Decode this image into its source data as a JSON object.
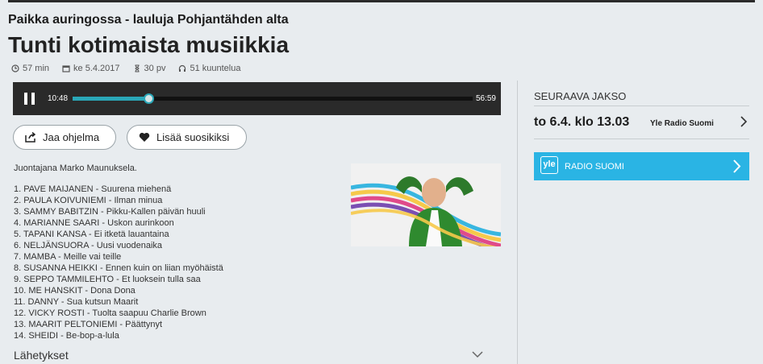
{
  "header": {
    "series": "Paikka auringossa - lauluja Pohjantähden alta",
    "title": "Tunti kotimaista musiikkia"
  },
  "meta": {
    "duration": "57 min",
    "date": "ke 5.4.2017",
    "availability": "30 pv",
    "listens": "51 kuuntelua"
  },
  "player": {
    "current_time": "10:48",
    "total_time": "56:59",
    "progress": 0.19
  },
  "actions": {
    "share_label": "Jaa ohjelma",
    "favorite_label": "Lisää suosikiksi"
  },
  "description": {
    "host": "Juontajana Marko Maunuksela."
  },
  "tracks": [
    "1. PAVE MAIJANEN - Suurena miehenä",
    "2. PAULA KOIVUNIEMI - Ilman minua",
    "3. SAMMY BABITZIN - Pikku-Kallen päivän huuli",
    "4. MARIANNE SAARI - Uskon aurinkoon",
    "5. TAPANI KANSA - Ei itketä lauantaina",
    "6. NELJÄNSUORA - Uusi vuodenaika",
    "7. MAMBA - Meille vai teille",
    "8. SUSANNA HEIKKI - Ennen kuin on liian myöhäistä",
    "9. SEPPO TAMMILEHTO - Et luoksein tulla saa",
    "10. ME HANSKIT - Dona Dona",
    "11. DANNY - Sua kutsun Maarit",
    "12. VICKY ROSTI - Tuolta saapuu Charlie Brown",
    "13. MAARIT PELTONIEMI - Päättynyt",
    "14. SHEIDI - Be-bop-a-lula"
  ],
  "broadcasts": {
    "label": "Lähetykset"
  },
  "next_episode": {
    "heading": "SEURAAVA JAKSO",
    "time": "to 6.4. klo 13.03",
    "channel": "Yle Radio Suomi"
  },
  "channel_link": {
    "logo": "yle",
    "name": "RADIO SUOMI",
    "color": "#2ab4e4"
  },
  "colors": {
    "accent": "#2aa7b8",
    "player_bg": "#2a2a2a",
    "page_bg": "#e8ecef"
  }
}
